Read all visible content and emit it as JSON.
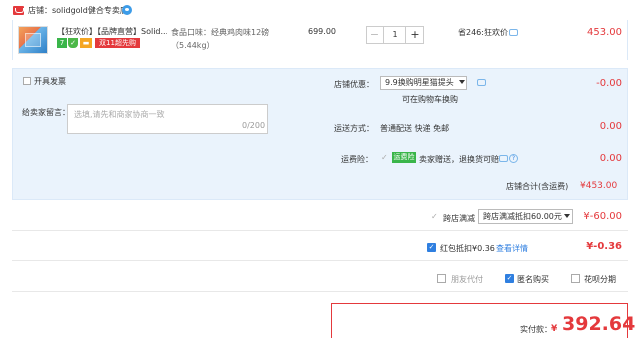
{
  "store": {
    "label": "店铺：solidgold健合专卖店"
  },
  "item": {
    "title": "【狂欢价】【品牌直营】Solid...",
    "tags": {
      "seven": "7",
      "shield": "✓",
      "card": "▬",
      "promo": "双11超先购"
    },
    "sku": "食品口味：经典鸡肉味12磅（5.44kg）",
    "unit_price": "699.00",
    "quantity": "1",
    "qty_minus": "−",
    "qty_plus": "+",
    "promotion": "省246:狂欢价",
    "total": "453.00"
  },
  "panel": {
    "invoice_label": "开具发票",
    "message_label": "给卖家留言：",
    "message_placeholder": "选填,请先和商家协商一致",
    "message_counter": "0/200",
    "coupon_label": "店铺优惠：",
    "coupon_value": "9.9换购明星猫提头",
    "coupon_hint": "可在购物车换购",
    "coupon_amount": "-0.00",
    "shipping_label": "运送方式：",
    "shipping_value": "普通配送 快递 免邮",
    "shipping_amount": "0.00",
    "insurance_label": "运费险：",
    "insurance_check": "✓",
    "insurance_badge": "运费险",
    "insurance_text": "卖家赠送，退换货可赔",
    "insurance_icon": "?",
    "insurance_amount": "0.00",
    "store_total_label": "店铺合计(含运费)",
    "store_total_amount": "¥453.00"
  },
  "cross_store": {
    "check": "✓",
    "label": "跨店满减",
    "select_value": "跨店满减抵扣60.00元",
    "amount": "¥-60.00"
  },
  "red_packet": {
    "check": "✓",
    "label": "红包抵扣¥0.36",
    "link": "查看详情",
    "amount": "¥-0.36"
  },
  "options": {
    "friend_pay": "朋友代付",
    "anonymous": "匿名购买",
    "anonymous_check": "✓",
    "huabei": "花呗分期"
  },
  "payment": {
    "label": "实付款：",
    "currency": "¥",
    "amount": "392.64"
  },
  "colors": {
    "accent_red": "#e4393c",
    "link_blue": "#2f7fe0",
    "panel_bg": "#eaf3fc"
  }
}
